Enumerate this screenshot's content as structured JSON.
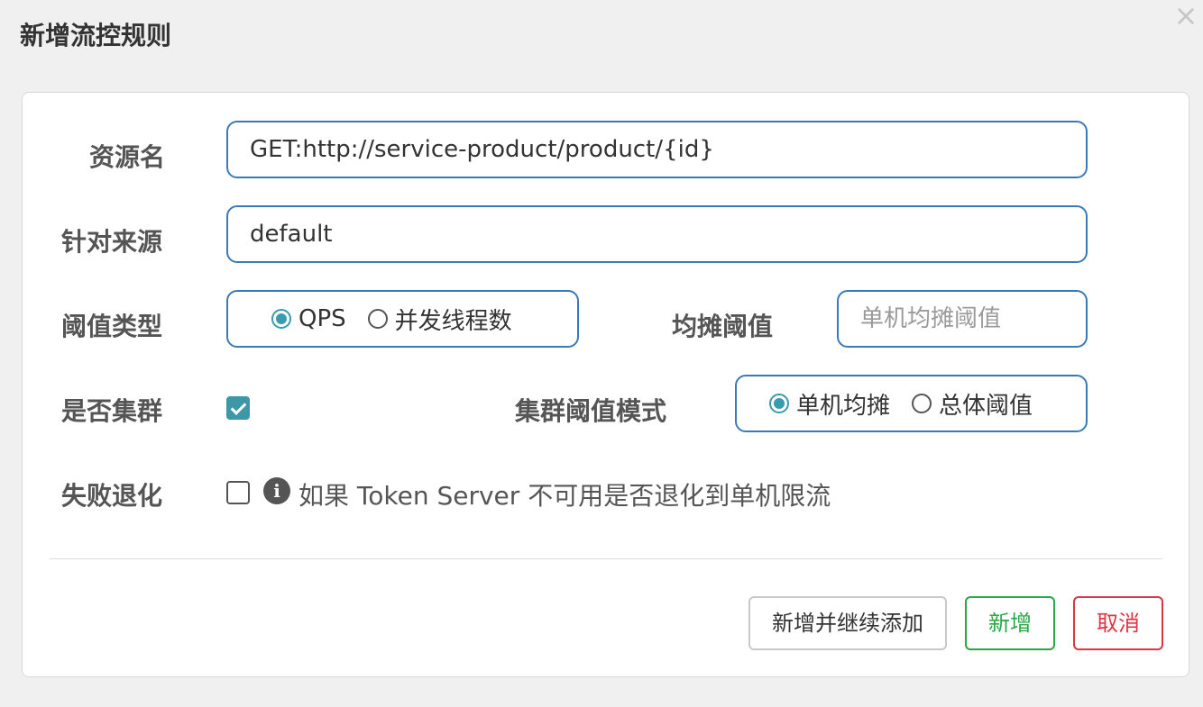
{
  "dialog": {
    "title": "新增流控规则",
    "close_label": "×"
  },
  "form": {
    "resource": {
      "label": "资源名",
      "value": "GET:http://service-product/product/{id}"
    },
    "limit_app": {
      "label": "针对来源",
      "value": "default"
    },
    "grade": {
      "label": "阈值类型",
      "options": [
        "QPS",
        "并发线程数"
      ],
      "selected": "QPS"
    },
    "threshold": {
      "label": "均摊阈值",
      "placeholder": "单机均摊阈值",
      "value": ""
    },
    "cluster": {
      "label": "是否集群",
      "checked": true
    },
    "cluster_mode": {
      "label": "集群阈值模式",
      "options": [
        "单机均摊",
        "总体阈值"
      ],
      "selected": "单机均摊"
    },
    "fallback": {
      "label": "失败退化",
      "checked": false,
      "info_icon": "i",
      "hint": "如果 Token Server 不可用是否退化到单机限流"
    }
  },
  "buttons": {
    "continue_label": "新增并继续添加",
    "add_label": "新增",
    "cancel_label": "取消"
  },
  "colors": {
    "input_border": "#3a7bb7",
    "checked": "#3d97a8",
    "success": "#28a745",
    "danger": "#dc3545"
  }
}
